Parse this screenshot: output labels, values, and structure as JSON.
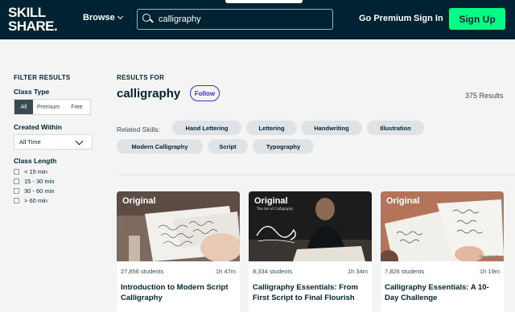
{
  "header": {
    "logo_line1": "SKILL",
    "logo_line2": "SHARE.",
    "browse": "Browse",
    "search_value": "calligraphy",
    "go_premium": "Go Premium",
    "sign_in": "Sign In",
    "sign_up": "Sign Up"
  },
  "filters": {
    "title": "FILTER RESULTS",
    "class_type_label": "Class Type",
    "class_type_options": [
      "All",
      "Premium",
      "Free"
    ],
    "created_within_label": "Created Within",
    "created_within_value": "All Time",
    "class_length_label": "Class Length",
    "class_length_options": [
      "< 15 min",
      "15 - 30 min",
      "30 - 60 min",
      "> 60 min"
    ]
  },
  "results": {
    "results_for": "RESULTS FOR",
    "query": "calligraphy",
    "follow": "Follow",
    "count": "375 Results",
    "related_label": "Related Skills:",
    "related_skills": [
      "Hand Lettering",
      "Lettering",
      "Handwriting",
      "Illustration",
      "Modern Calligraphy",
      "Script",
      "Typography"
    ]
  },
  "cards": [
    {
      "badge": "Original",
      "students": "27,856 students",
      "duration": "1h 47m",
      "title": "Introduction to Modern Script Calligraphy"
    },
    {
      "badge": "Original",
      "students": "8,334 students",
      "duration": "1h 34m",
      "title": "Calligraphy Essentials: From First Script to Final Flourish",
      "thumb_text": "The Art of Calligraphy"
    },
    {
      "badge": "Original",
      "students": "7,826 students",
      "duration": "1h 19m",
      "title": "Calligraphy Essentials: A 10-Day Challenge",
      "thumb_text": "SKILLSHARE"
    }
  ],
  "colors": {
    "header_bg": "#002333",
    "signup_green": "#00ff84",
    "follow_purple": "#3d2fd4"
  }
}
